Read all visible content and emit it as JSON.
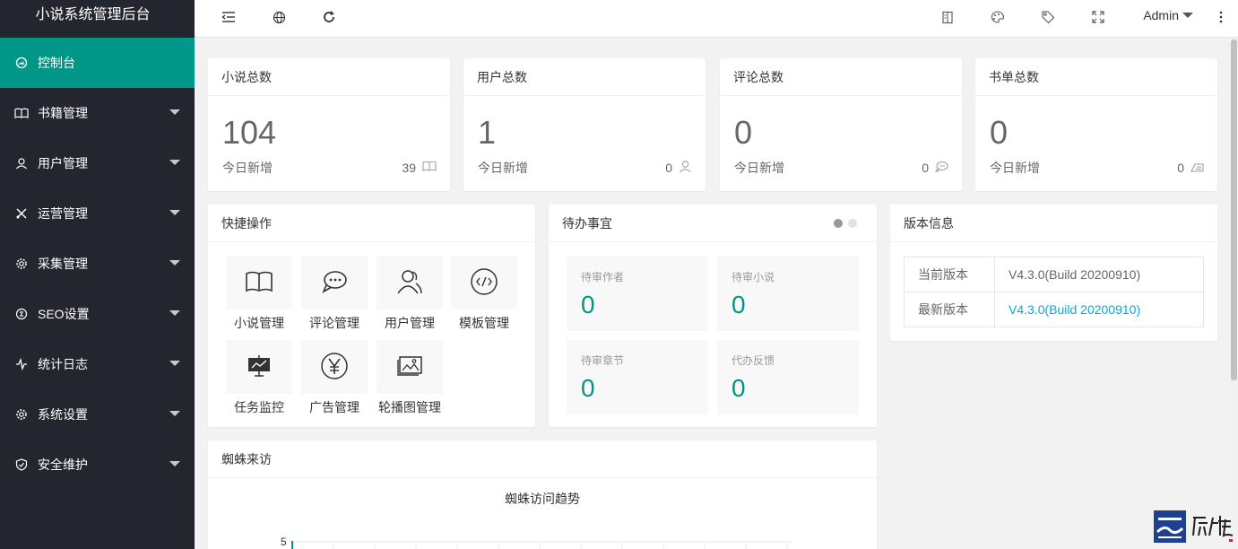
{
  "app": {
    "title": "小说系统管理后台"
  },
  "sidebar": {
    "items": [
      {
        "label": "控制台",
        "icon": "dashboard-icon",
        "active": true
      },
      {
        "label": "书籍管理",
        "icon": "book-icon"
      },
      {
        "label": "用户管理",
        "icon": "user-icon"
      },
      {
        "label": "运营管理",
        "icon": "tools-icon"
      },
      {
        "label": "采集管理",
        "icon": "gear-icon"
      },
      {
        "label": "SEO设置",
        "icon": "seo-icon"
      },
      {
        "label": "统计日志",
        "icon": "pulse-icon"
      },
      {
        "label": "系统设置",
        "icon": "settings-icon"
      },
      {
        "label": "安全维护",
        "icon": "shield-icon"
      }
    ]
  },
  "header": {
    "user": "Admin",
    "icons": [
      "menu-fold-icon",
      "globe-icon",
      "refresh-icon",
      "note-icon",
      "theme-icon",
      "tag-icon",
      "fullscreen-icon",
      "more-icon"
    ]
  },
  "stats": [
    {
      "title": "小说总数",
      "value": "104",
      "foot_label": "今日新增",
      "foot_value": "39",
      "icon": "book-icon"
    },
    {
      "title": "用户总数",
      "value": "1",
      "foot_label": "今日新增",
      "foot_value": "0",
      "icon": "user-icon"
    },
    {
      "title": "评论总数",
      "value": "0",
      "foot_label": "今日新增",
      "foot_value": "0",
      "icon": "comment-icon"
    },
    {
      "title": "书单总数",
      "value": "0",
      "foot_label": "今日新增",
      "foot_value": "0",
      "icon": "booklist-icon"
    }
  ],
  "quick": {
    "title": "快捷操作",
    "items": [
      {
        "label": "小说管理",
        "icon": "book-open-icon"
      },
      {
        "label": "评论管理",
        "icon": "comment-icon"
      },
      {
        "label": "用户管理",
        "icon": "users-icon"
      },
      {
        "label": "模板管理",
        "icon": "code-icon"
      },
      {
        "label": "任务监控",
        "icon": "monitor-icon"
      },
      {
        "label": "广告管理",
        "icon": "yen-icon"
      },
      {
        "label": "轮播图管理",
        "icon": "image-icon"
      }
    ]
  },
  "todo": {
    "title": "待办事宜",
    "items": [
      {
        "label": "待审作者",
        "value": "0"
      },
      {
        "label": "待审小说",
        "value": "0"
      },
      {
        "label": "待审章节",
        "value": "0"
      },
      {
        "label": "代办反馈",
        "value": "0"
      }
    ]
  },
  "version": {
    "title": "版本信息",
    "rows": [
      {
        "key": "当前版本",
        "value": "V4.3.0(Build 20200910)",
        "link": false
      },
      {
        "key": "最新版本",
        "value": "V4.3.0(Build 20200910)",
        "link": true
      }
    ]
  },
  "spider": {
    "title": "蜘蛛来访",
    "chart_title": "蜘蛛访问趋势",
    "y_tick_top": "5"
  },
  "colors": {
    "accent": "#009688",
    "sidebar": "#23262e",
    "link": "#01aaed"
  }
}
